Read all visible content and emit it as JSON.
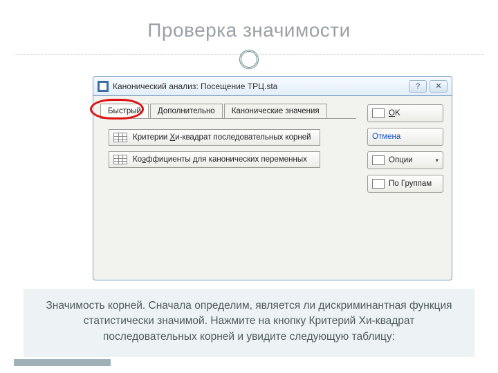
{
  "slide": {
    "title": "Проверка значимости",
    "caption": "Значимость корней. Сначала определим, является ли дискриминантная функция статистически значимой. Нажмите на кнопку Критерий Хи-квадрат последовательных корней и увидите следующую таблицу:"
  },
  "window": {
    "title": "Канонический анализ: Посещение ТРЦ.sta",
    "help_glyph": "?",
    "close_glyph": "✕"
  },
  "tabs": {
    "items": [
      {
        "label": "Быстрый"
      },
      {
        "label": "Дополнительно"
      },
      {
        "label": "Канонические значения"
      }
    ]
  },
  "main_buttons": {
    "chi_prefix": "Критерии ",
    "chi_uchar": "Х",
    "chi_suffix": "и-квадрат последовательных корней",
    "coef_prefix": "Ко",
    "coef_uchar": "э",
    "coef_suffix": "ффициенты для канонических переменных"
  },
  "right": {
    "ok_uchar": "O",
    "ok_suffix": "K",
    "cancel": "Отмена",
    "options": "Опции",
    "bygroups": "По Группам"
  }
}
